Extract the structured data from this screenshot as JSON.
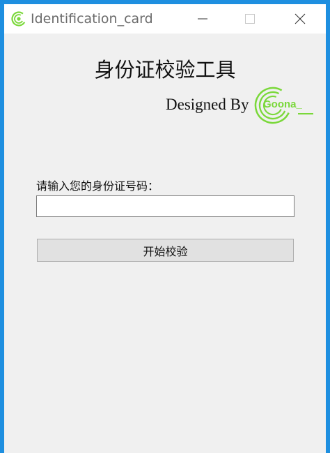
{
  "window": {
    "title": "Identification_card",
    "icon": "goona-logo-icon",
    "controls": {
      "minimize_icon": "minimize-icon",
      "maximize_icon": "maximize-icon",
      "close_icon": "close-icon"
    }
  },
  "main": {
    "heading": "身份证校验工具",
    "designed_by": "Designed By",
    "brand_logo_text": "Goona_",
    "input_label": "请输入您的身份证号码：",
    "id_input": {
      "value": "",
      "placeholder": ""
    },
    "verify_button_label": "开始校验"
  },
  "colors": {
    "desktop_accent": "#1e8fe0",
    "window_background": "#f0f0f0",
    "titlebar": "#ffffff",
    "brand_green": "#7ad83a"
  }
}
